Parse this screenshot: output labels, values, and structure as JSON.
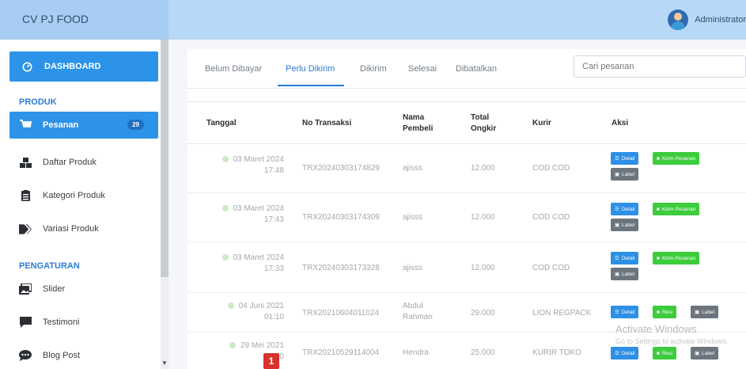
{
  "app": {
    "brand": "CV PJ FOOD",
    "user": "Administrator"
  },
  "sidebar": {
    "dashboard": "DASHBOARD",
    "section_produk": "PRODUK",
    "produk_items": [
      {
        "label": "Pesanan",
        "badge": "29"
      },
      {
        "label": "Daftar Produk"
      },
      {
        "label": "Kategori Produk"
      },
      {
        "label": "Variasi Produk"
      }
    ],
    "section_pengaturan": "PENGATURAN",
    "pengaturan_items": [
      {
        "label": "Slider"
      },
      {
        "label": "Testimoni"
      },
      {
        "label": "Blog Post"
      }
    ]
  },
  "tabs": [
    "Belum Dibayar",
    "Perlu Dikirim",
    "Dikirim",
    "Selesai",
    "Dibatalkan"
  ],
  "active_tab": "Perlu Dikirim",
  "search": {
    "placeholder": "Cari pesanan"
  },
  "table": {
    "headers": {
      "tanggal": "Tanggal",
      "no": "No Transaksi",
      "nama1": "Nama",
      "nama2": "Pembeli",
      "total1": "Total",
      "total2": "Ongkir",
      "kurir": "Kurir",
      "aksi": "Aksi"
    },
    "rows": [
      {
        "date": "03 Maret 2024",
        "time": "17:48",
        "no": "TRX20240303174829",
        "nama": "ajisss",
        "total": "12.000",
        "kurir": "COD COD"
      },
      {
        "date": "03 Maret 2024",
        "time": "17:43",
        "no": "TRX20240303174309",
        "nama": "ajisss",
        "total": "12.000",
        "kurir": "COD COD"
      },
      {
        "date": "03 Maret 2024",
        "time": "17:33",
        "no": "TRX20240303173328",
        "nama": "ajisss",
        "total": "12.000",
        "kurir": "COD COD"
      },
      {
        "date": "04 Juni 2021",
        "time": "01:10",
        "no": "TRX20210604011024",
        "nama1": "Abdul",
        "nama2": "Rahman",
        "total": "29.000",
        "kurir": "LION REGPACK"
      },
      {
        "date": "29 Mei 2021",
        "time": "11:40",
        "no": "TRX20210529114004",
        "nama": "Hendra",
        "total": "25.000",
        "kurir": "KURIR TOKO"
      }
    ]
  },
  "buttons": {
    "detail": "Detail",
    "kirim": "Kirim Pesanan",
    "resi": "Resi",
    "label": "Label"
  },
  "watermark": {
    "title": "Activate Windows",
    "sub": "Go to Settings to activate Windows."
  },
  "overlay_badge": "1",
  "colors": {
    "primary": "#2d93e8",
    "success": "#3ccc3c",
    "secondary": "#6c757d",
    "topbar": "#b8d8f7"
  }
}
